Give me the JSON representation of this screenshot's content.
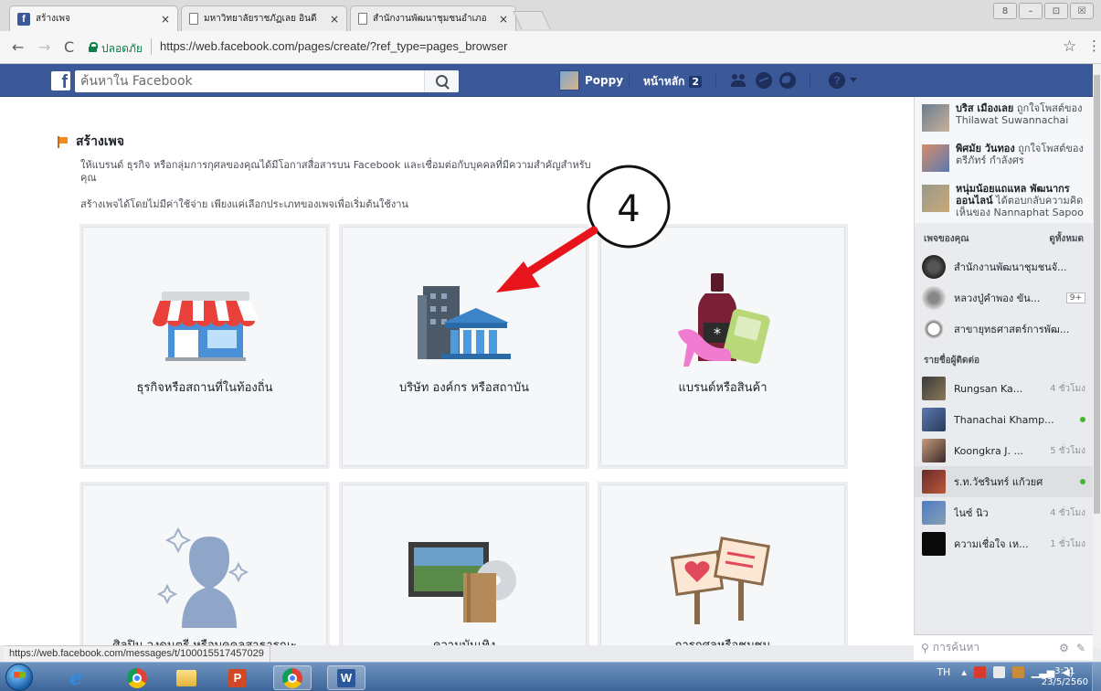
{
  "browser": {
    "tabs": [
      {
        "title": "สร้างเพจ",
        "icon": "facebook-favicon",
        "active": true
      },
      {
        "title": "มหาวิทยาลัยราชภัฏเลย อินดี",
        "icon": "document-favicon",
        "active": false
      },
      {
        "title": "สำนักงานพัฒนาชุมชนอำเภอ",
        "icon": "document-favicon",
        "active": false
      }
    ],
    "tab_close": "×",
    "window_controls": [
      "8",
      "–",
      "⊡",
      "☒"
    ],
    "security_label": "ปลอดภัย",
    "url": "https://web.facebook.com/pages/create/?ref_type=pages_browser"
  },
  "fb_header": {
    "logo": "f",
    "search_placeholder": "ค้นหาใน Facebook",
    "profile_name": "Poppy",
    "home_label": "หน้าหลัก",
    "home_count": "2",
    "help_glyph": "?"
  },
  "page": {
    "title": "สร้างเพจ",
    "description": "ให้แบรนด์ ธุรกิจ หรือกลุ่มการกุศลของคุณได้มีโอกาสสื่อสารบน Facebook และเชื่อมต่อกับบุคคลที่มีความสำคัญสำหรับคุณ",
    "subdescription": "สร้างเพจได้โดยไม่มีค่าใช้จ่าย เพียงแค่เลือกประเภทของเพจเพื่อเริ่มต้นใช้งาน",
    "categories": [
      {
        "label": "ธุรกิจหรือสถานที่ในท้องถิ่น",
        "icon": "storefront-icon"
      },
      {
        "label": "บริษัท องค์กร หรือสถาบัน",
        "icon": "institution-building-icon"
      },
      {
        "label": "แบรนด์หรือสินค้า",
        "icon": "brand-products-icon"
      },
      {
        "label": "ศิลปิน วงดนตรี หรือบุคคลสาธารณะ",
        "icon": "public-figure-icon"
      },
      {
        "label": "ความบันเทิง",
        "icon": "entertainment-icon"
      },
      {
        "label": "การกุศลหรือชุมชน",
        "icon": "community-signs-icon"
      }
    ],
    "annotation_number": "4",
    "accent_red": "#e8141c"
  },
  "sidebar": {
    "ticker": [
      {
        "name": "บริส เมืองเลย",
        "action": "ถูกใจโพสต์ของ Thilawat Suwannachai"
      },
      {
        "name": "พิศมัย วันทอง",
        "action": "ถูกใจโพสต์ของ ตรีภัทร์ กำลังศร"
      },
      {
        "name": "หนุ่มน้อยแถแหล พัฒนากรออนไลน์",
        "action": "ได้ตอบกลับความคิดเห็นของ Nannaphat Sapoo"
      }
    ],
    "pages_header": "เพจของคุณ",
    "pages_see_all": "ดูทั้งหมด",
    "pages": [
      {
        "name": "สำนักงานพัฒนาชุมชนจั...",
        "badge": ""
      },
      {
        "name": "หลวงปู่คำพอง ขัน...",
        "badge": "9+"
      },
      {
        "name": "สาขายุทธศาสตร์การพัฒ...",
        "badge": ""
      }
    ],
    "contacts_header": "รายชื่อผู้ติดต่อ",
    "contacts": [
      {
        "name": "Rungsan Ka...",
        "meta": "4 ชั่วโมง",
        "online": false,
        "highlight": false
      },
      {
        "name": "Thanachai Khamp...",
        "meta": "",
        "online": true,
        "highlight": false
      },
      {
        "name": "Koongkra J. ...",
        "meta": "5 ชั่วโมง",
        "online": false,
        "highlight": false
      },
      {
        "name": "ร.ท.วัชรินทร์ แก้วยศ",
        "meta": "",
        "online": true,
        "highlight": true
      },
      {
        "name": "ไนซ์ นิว",
        "meta": "4 ชั่วโมง",
        "online": false,
        "highlight": false
      },
      {
        "name": "ความเชื่อใจ เห...",
        "meta": "1 ชั่วโมง",
        "online": false,
        "highlight": false
      }
    ],
    "chat_search_placeholder": "การค้นหา"
  },
  "status_url": "https://web.facebook.com/messages/t/100015517457029",
  "taskbar": {
    "lang": "TH",
    "time": "3:21",
    "date": "23/5/2560"
  }
}
